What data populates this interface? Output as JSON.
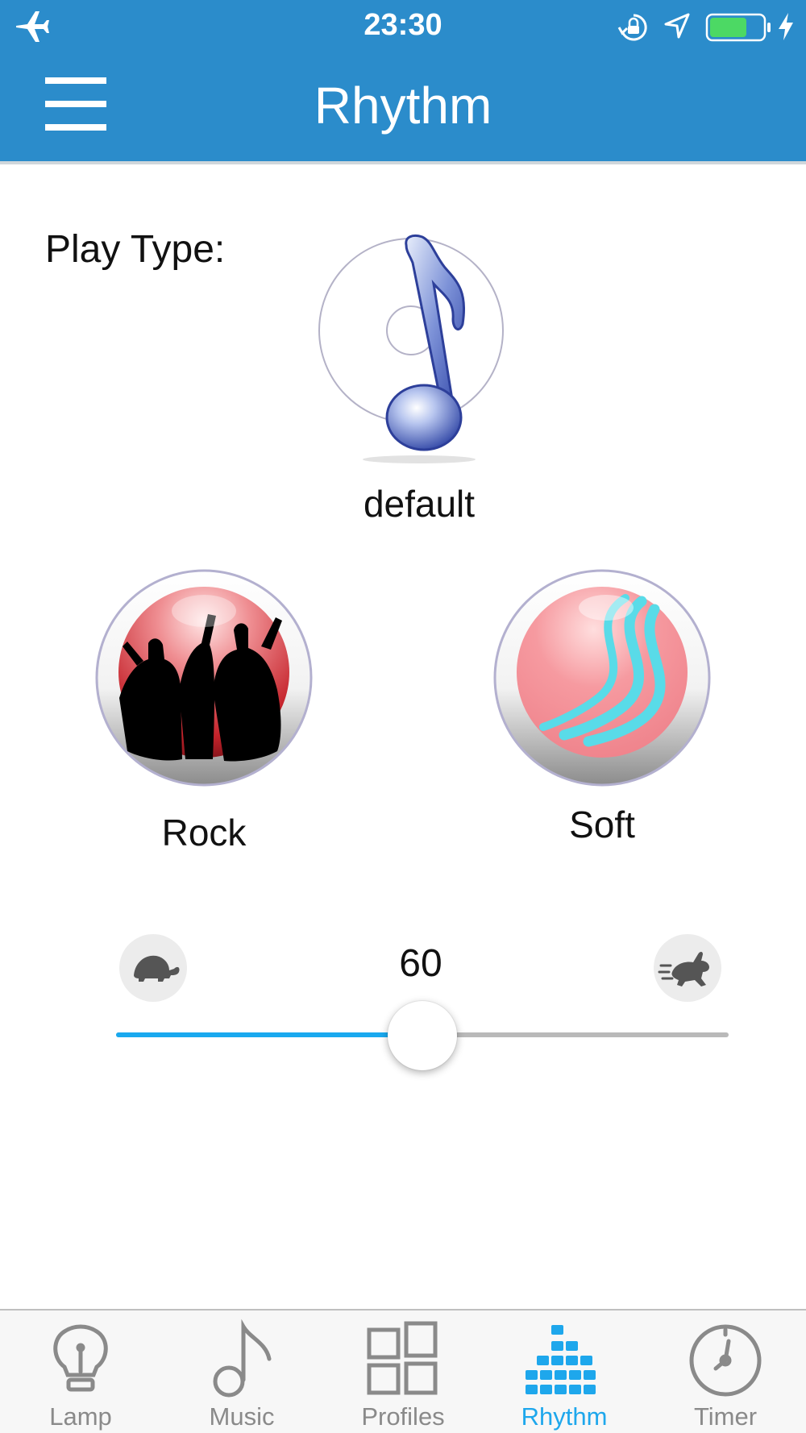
{
  "status_bar": {
    "time": "23:30",
    "icons": [
      "airplane-icon",
      "rotation-lock-icon",
      "location-arrow-icon",
      "battery-icon",
      "charging-icon"
    ],
    "battery_level": 0.7,
    "battery_color": "#4cd964"
  },
  "header": {
    "title": "Rhythm",
    "menu_icon": "hamburger-menu-icon",
    "background_color": "#2b8ccb"
  },
  "play_type": {
    "label": "Play Type:",
    "current": "default",
    "options": [
      {
        "label": "Rock",
        "icon": "dancing-crowd-icon"
      },
      {
        "label": "Soft",
        "icon": "soft-waves-icon"
      }
    ]
  },
  "speed": {
    "value": "60",
    "fraction": 0.5,
    "slow_icon": "turtle-icon",
    "fast_icon": "rabbit-icon",
    "fill_color": "#19a9ef"
  },
  "tabs": [
    {
      "label": "Lamp",
      "icon": "lightbulb-icon",
      "active": false
    },
    {
      "label": "Music",
      "icon": "music-note-icon",
      "active": false
    },
    {
      "label": "Profiles",
      "icon": "grid-icon",
      "active": false
    },
    {
      "label": "Rhythm",
      "icon": "equalizer-icon",
      "active": true
    },
    {
      "label": "Timer",
      "icon": "clock-icon",
      "active": false
    }
  ],
  "colors": {
    "tab_active": "#1ea7ec",
    "tab_inactive": "#8a8a8a"
  }
}
